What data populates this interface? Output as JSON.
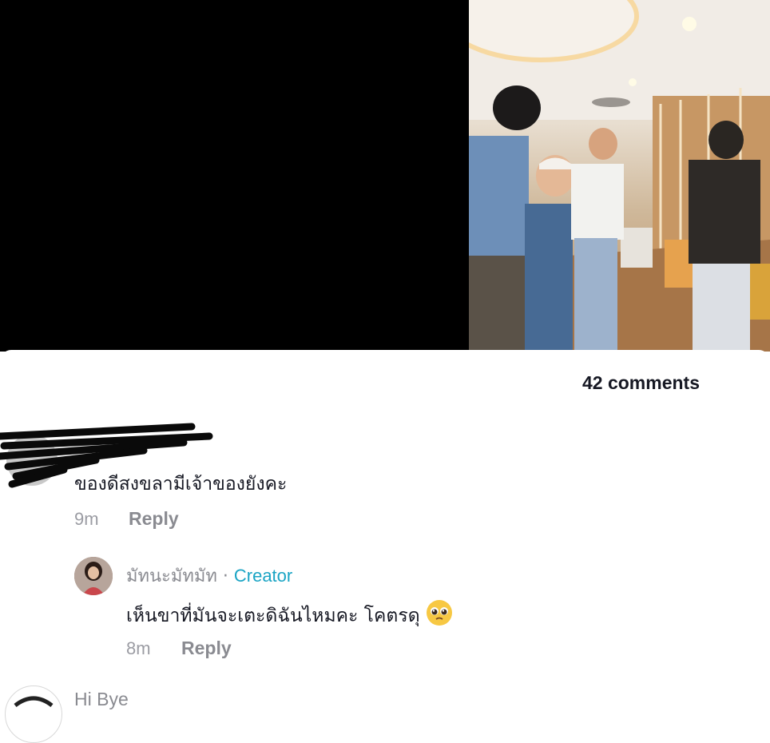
{
  "comments_header": {
    "count_label": "42 comments"
  },
  "comments": [
    {
      "text": "ของดีสงขลามีเจ้าของยังคะ",
      "time": "9m",
      "reply_label": "Reply"
    }
  ],
  "reply": {
    "username": "มัทนะมัทมัท",
    "separator": "·",
    "badge": "Creator",
    "text": "เห็นขาที่มันจะเตะดิฉันไหมคะ โคตรดุ",
    "emoji": "pleading-face",
    "time": "8m",
    "reply_label": "Reply"
  },
  "next_comment": {
    "username": "Hi Bye"
  },
  "colors": {
    "creator_badge": "#1aa4c4",
    "meta_gray": "#9b9ca3",
    "text": "#161823"
  }
}
